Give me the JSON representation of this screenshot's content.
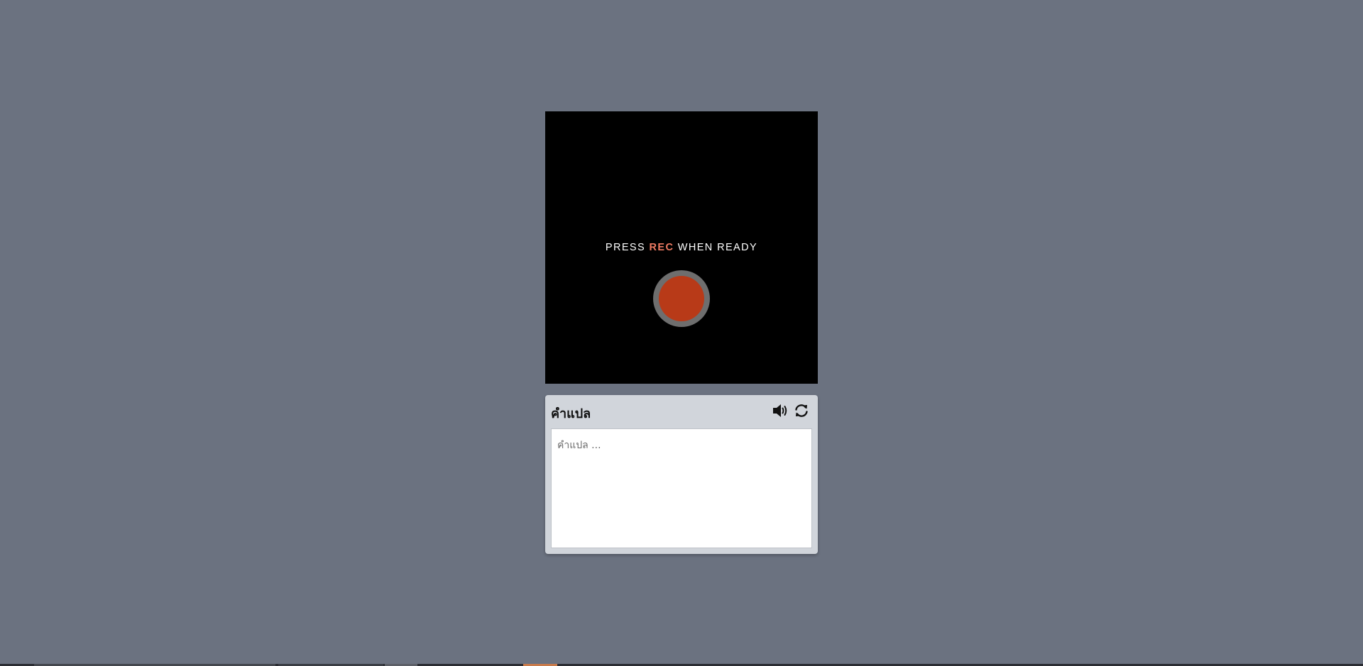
{
  "recorder": {
    "prompt_before": "PRESS ",
    "prompt_rec": "REC",
    "prompt_after": " WHEN READY",
    "accent_color": "#ef7b63",
    "button_color": "#b83a18"
  },
  "translation_panel": {
    "title": "คำแปล",
    "placeholder": "คำแปล ...",
    "value": "",
    "speaker_icon": "speaker-icon",
    "refresh_icon": "refresh-icon"
  },
  "colors": {
    "background": "#6b7280",
    "panel": "#d1d5db",
    "stage": "#000000"
  }
}
